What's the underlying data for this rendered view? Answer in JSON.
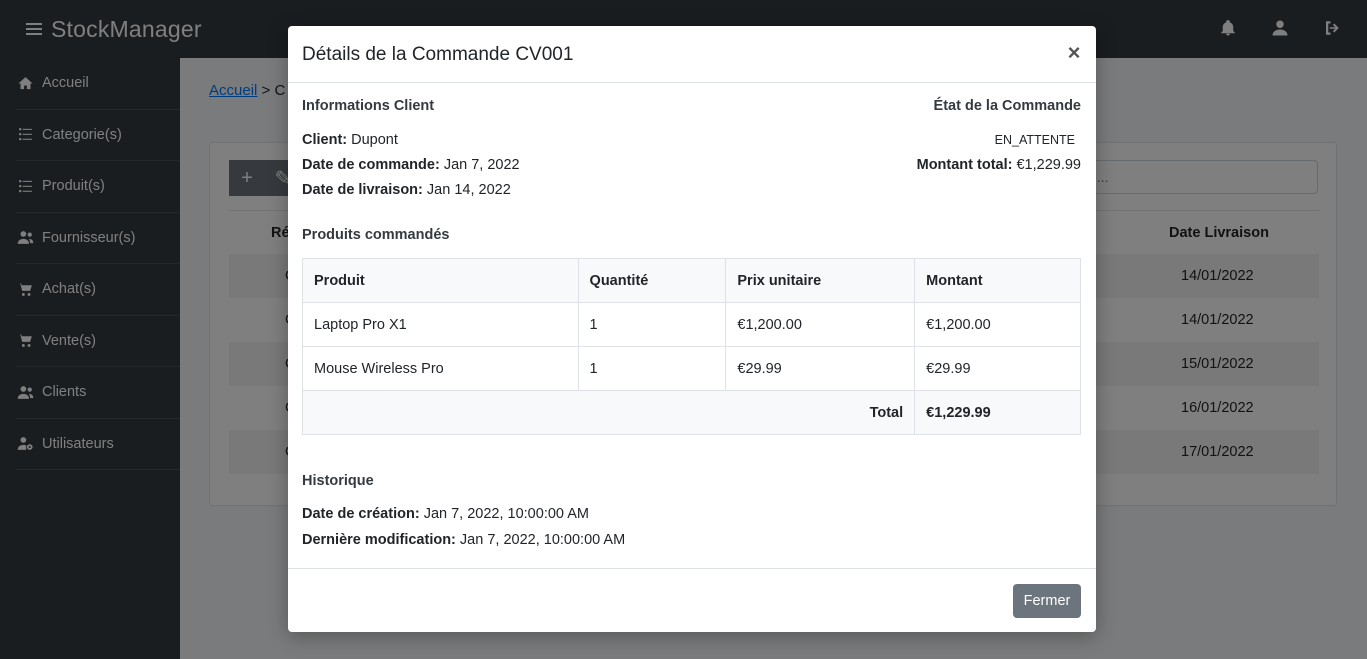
{
  "app": {
    "brand": "StockManager"
  },
  "sidebar": {
    "items": [
      {
        "label": "Accueil",
        "icon": "home-icon"
      },
      {
        "label": "Categorie(s)",
        "icon": "list-icon"
      },
      {
        "label": "Produit(s)",
        "icon": "list-icon"
      },
      {
        "label": "Fournisseur(s)",
        "icon": "users-icon"
      },
      {
        "label": "Achat(s)",
        "icon": "cart-icon"
      },
      {
        "label": "Vente(s)",
        "icon": "cart-icon"
      },
      {
        "label": "Clients",
        "icon": "users-icon"
      },
      {
        "label": "Utilisateurs",
        "icon": "users-gear-icon"
      }
    ]
  },
  "topbar": {
    "icons": [
      "bell-icon",
      "user-icon",
      "logout-icon"
    ]
  },
  "background": {
    "breadcrumb": {
      "home": "Accueil",
      "separator": ">",
      "current": "C"
    },
    "search_placeholder": "h...",
    "table": {
      "headers": [
        "Ré",
        "Date Livraison"
      ],
      "rows": [
        {
          "ref": "C",
          "date": "14/01/2022"
        },
        {
          "ref": "C",
          "date": "14/01/2022"
        },
        {
          "ref": "C",
          "date": "15/01/2022"
        },
        {
          "ref": "C",
          "date": "16/01/2022"
        },
        {
          "ref": "C",
          "date": "17/01/2022"
        }
      ]
    }
  },
  "modal": {
    "title": "Détails de la Commande CV001",
    "close_symbol": "×",
    "client_section": "Informations Client",
    "status_section": "État de la Commande",
    "client_label": "Client:",
    "client_value": "Dupont",
    "order_date_label": "Date de commande:",
    "order_date_value": "Jan 7, 2022",
    "delivery_date_label": "Date de livraison:",
    "delivery_date_value": "Jan 14, 2022",
    "status_value": "EN_ATTENTE",
    "total_amount_label": "Montant total:",
    "total_amount_value": "€1,229.99",
    "products_section": "Produits commandés",
    "products_table": {
      "headers": [
        "Produit",
        "Quantité",
        "Prix unitaire",
        "Montant"
      ],
      "rows": [
        {
          "product": "Laptop Pro X1",
          "qty": "1",
          "unit_price": "€1,200.00",
          "amount": "€1,200.00"
        },
        {
          "product": "Mouse Wireless Pro",
          "qty": "1",
          "unit_price": "€29.99",
          "amount": "€29.99"
        }
      ],
      "total_label": "Total",
      "total_value": "€1,229.99"
    },
    "history_section": "Historique",
    "created_label": "Date de création:",
    "created_value": "Jan 7, 2022, 10:00:00 AM",
    "modified_label": "Dernière modification:",
    "modified_value": "Jan 7, 2022, 10:00:00 AM",
    "close_button": "Fermer"
  }
}
